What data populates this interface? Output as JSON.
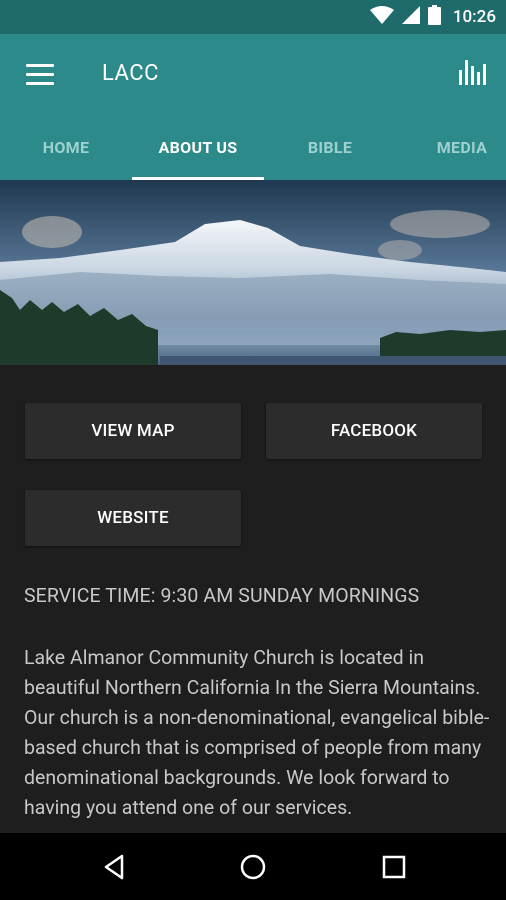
{
  "status_bar": {
    "time": "10:26"
  },
  "app_bar": {
    "title": "LACC"
  },
  "tabs": [
    {
      "label": "HOME"
    },
    {
      "label": "ABOUT US"
    },
    {
      "label": "BIBLE"
    },
    {
      "label": "MEDIA"
    }
  ],
  "buttons": {
    "view_map": "VIEW MAP",
    "facebook": "FACEBOOK",
    "website": "WEBSITE"
  },
  "service_time": "SERVICE TIME: 9:30 AM  SUNDAY MORNINGS",
  "description": "Lake Almanor Community Church is located in beautiful Northern California In the Sierra Mountains.  Our church is a non-denominational, evangelical bible-based church that is comprised of people from many denominational backgrounds. We look forward to having you attend one of our services.",
  "colors": {
    "status_bar": "#1f6b6c",
    "app_bar": "#2c8a8a",
    "background": "#1e1e1e",
    "button": "#2c2c2c"
  },
  "icons": [
    "wifi-icon",
    "signal-icon",
    "battery-icon",
    "menu-icon",
    "bar-chart-icon",
    "back-icon",
    "home-icon",
    "recents-icon"
  ]
}
